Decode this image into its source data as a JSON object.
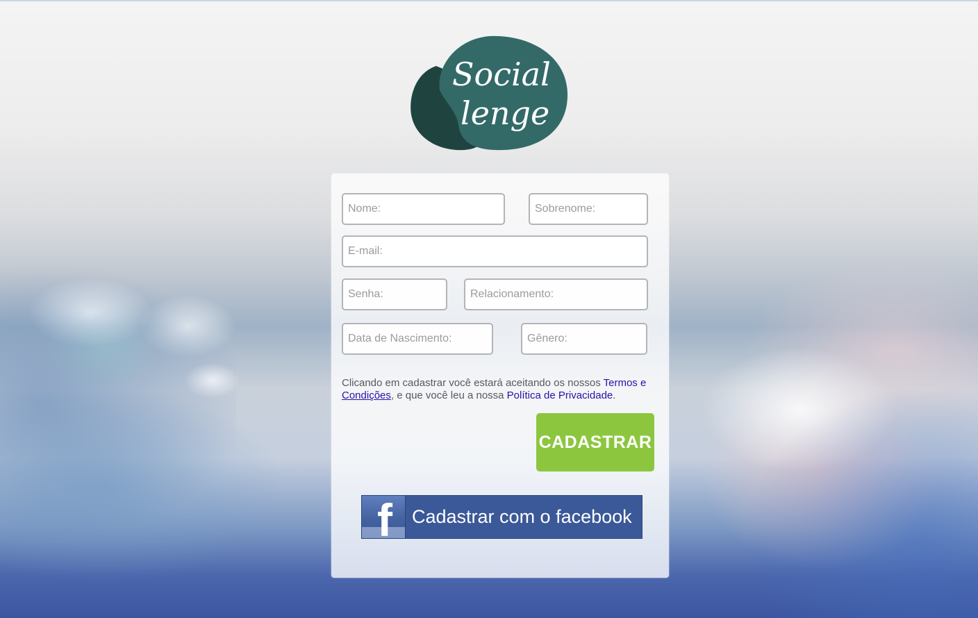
{
  "brand": {
    "logo_line1": "Social",
    "logo_line2": "lenge",
    "logo_primary_color": "#336a68",
    "logo_shadow_color": "#1f4440"
  },
  "form": {
    "nome_placeholder": "Nome:",
    "sobrenome_placeholder": "Sobrenome:",
    "email_placeholder": "E-mail:",
    "senha_placeholder": "Senha:",
    "relacionamento_placeholder": "Relacionamento:",
    "nascimento_placeholder": "Data de Nascimento:",
    "genero_placeholder": "Gênero:"
  },
  "terms": {
    "text_before": "Clicando em cadastrar você estará aceitando os nossos ",
    "terms_link": "Termos e",
    "terms_link_cont": "Condições",
    "text_middle": ", e que você leu a nossa ",
    "privacy_link": "Política de Privacidade",
    "text_after": "."
  },
  "buttons": {
    "submit_label": "CADASTRAR",
    "facebook_label": "Cadastrar com o facebook",
    "facebook_icon_glyph": "f"
  },
  "colors": {
    "submit_bg": "#8cc63f",
    "facebook_bg": "#3b5998",
    "link": "#2612a8"
  }
}
